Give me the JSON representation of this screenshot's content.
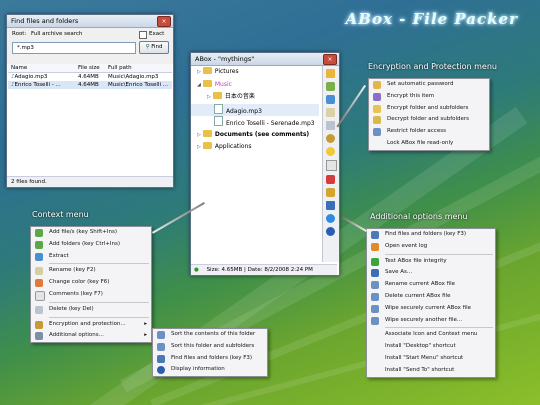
{
  "app_title": "ABox - File Packer",
  "find_window": {
    "title": "Find files and folders",
    "close": "×",
    "root_label": "Root:",
    "root_value": "Full archive search",
    "exact_label": "Exact",
    "query": "*.mp3",
    "find_button": "Find",
    "columns": [
      "Name",
      "File size",
      "Full path"
    ],
    "rows": [
      {
        "name": "Adagio.mp3",
        "size": "4.64MB",
        "path": "Music\\Adagio.mp3"
      },
      {
        "name": "Enrico Toselli - ...",
        "size": "4.64MB",
        "path": "Music\\Enrico Toselli ..."
      }
    ],
    "status": "2 files found."
  },
  "abox_window": {
    "title": "ABox - \"mythings\"",
    "tree": [
      {
        "label": "Pictures",
        "indent": 0,
        "type": "folder",
        "exp": "▷"
      },
      {
        "label": "Music",
        "indent": 0,
        "type": "folder",
        "exp": "◢"
      },
      {
        "label": "日本の音楽",
        "indent": 1,
        "type": "folder",
        "exp": "▷"
      },
      {
        "label": "Adagio.mp3",
        "indent": 1,
        "type": "file",
        "exp": ""
      },
      {
        "label": "Enrico Toselli - Serenade.mp3",
        "indent": 1,
        "type": "file",
        "exp": ""
      },
      {
        "label": "Documents (see comments)",
        "indent": 0,
        "type": "folder",
        "exp": "▷"
      },
      {
        "label": "Applications",
        "indent": 0,
        "type": "folder",
        "exp": "▷"
      }
    ],
    "status": "Size: 4.65MB | Date: 8/2/2008 2:24 PM"
  },
  "captions": {
    "encryption": "Encryption and Protection menu",
    "context": "Context menu",
    "additional": "Additional options menu"
  },
  "encryption_menu": [
    "Set automatic password",
    "Encrypt this item",
    "Encrypt folder and subfolders",
    "Decrypt folder and subfolders",
    "Restrict folder access",
    "Lock ABox file read-only"
  ],
  "context_menu": [
    "Add file/s (key Shift+Ins)",
    "Add folders (key Ctrl+Ins)",
    "Extract",
    "Rename (key F2)",
    "Change color (key F6)",
    "Comments (key F7)",
    "Delete (key Del)",
    "Encryption and protection...",
    "Additional options..."
  ],
  "sub_menu": [
    "Sort the contents of this folder",
    "Sort this folder and subfolders",
    "Find files and folders (key F3)",
    "Display information"
  ],
  "additional_menu": [
    "Find files and folders (key F3)",
    "Open event log",
    "Test ABox file integrity",
    "Save As...",
    "Rename current ABox file",
    "Delete current ABox file",
    "Wipe securely current ABox file",
    "Wipe securely another file...",
    "Associate Icon and Context menu",
    "Install \"Desktop\" shortcut",
    "Install \"Start Menu\" shortcut",
    "Install \"Send To\" shortcut"
  ]
}
